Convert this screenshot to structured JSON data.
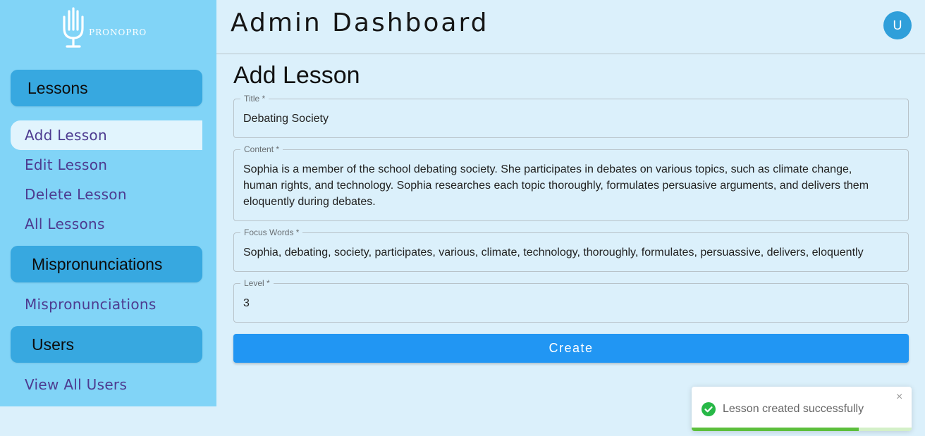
{
  "app": {
    "logo_text": "PRONOPRO"
  },
  "header": {
    "title": "Admin Dashboard",
    "avatar_initial": "U"
  },
  "sidebar": {
    "sections": [
      {
        "title": "Lessons",
        "items": [
          "Add Lesson",
          "Edit Lesson",
          "Delete Lesson",
          "All Lessons"
        ]
      },
      {
        "title": "Mispronunciations",
        "items": [
          "Mispronunciations"
        ]
      },
      {
        "title": "Users",
        "items": [
          "View All Users"
        ]
      }
    ],
    "active_item": "Add Lesson"
  },
  "form": {
    "title": "Add Lesson",
    "fields": {
      "title": {
        "label": "Title *",
        "value": "Debating Society"
      },
      "content": {
        "label": "Content *",
        "value": "Sophia is a member of the school debating society. She participates in debates on various topics, such as climate change, human rights, and technology. Sophia researches each topic thoroughly, formulates persuasive arguments, and delivers them eloquently during debates."
      },
      "focus_words": {
        "label": "Focus Words *",
        "value": "Sophia, debating, society, participates, various, climate, technology, thoroughly, formulates, persuassive, delivers, eloquently"
      },
      "level": {
        "label": "Level *",
        "value": "3"
      }
    },
    "submit_label": "Create"
  },
  "toast": {
    "message": "Lesson created successfully",
    "close_symbol": "×",
    "type": "success",
    "progress_percent": 76
  },
  "colors": {
    "sidebar_bg": "#81d4f7",
    "section_bg": "#37a8e0",
    "page_bg": "#dbf0fb",
    "accent": "#2196f3",
    "nav_text": "#4d3b90",
    "success": "#27b847"
  },
  "icons": {
    "logo": "microphone-hand-icon",
    "toast": "check-circle-icon",
    "close": "close-icon"
  }
}
